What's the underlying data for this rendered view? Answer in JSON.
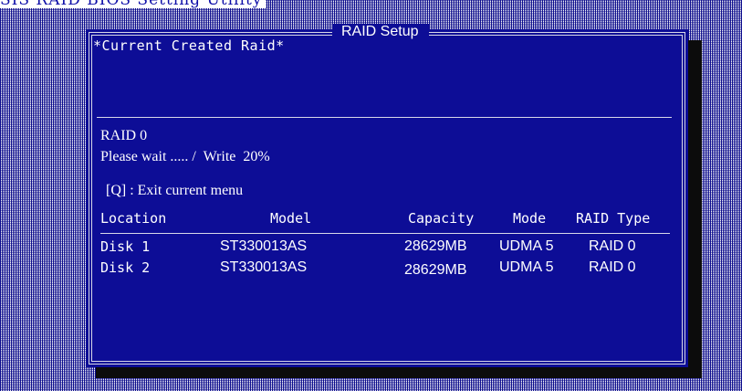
{
  "app_title": "SIS RAID BIOS Setting Utility",
  "panel": {
    "title": "RAID Setup",
    "created_heading": "*Current Created Raid*",
    "raid_label": "RAID 0",
    "progress_text": "Please wait ..... /  Write  20%",
    "progress_percent": 20,
    "exit_hint": "[Q] : Exit current menu"
  },
  "table": {
    "headers": {
      "location": "Location",
      "model": "Model",
      "capacity": "Capacity",
      "mode": "Mode",
      "raid_type": "RAID Type"
    },
    "rows": [
      {
        "location": "Disk 1",
        "model": "ST330013AS",
        "capacity": "28629MB",
        "mode": "UDMA 5",
        "raid_type": "RAID 0"
      },
      {
        "location": "Disk 2",
        "model": "ST330013AS",
        "capacity": "28629MB",
        "mode": "UDMA 5",
        "raid_type": "RAID 0"
      }
    ]
  },
  "colors": {
    "panel_bg": "#0d0da8",
    "text": "#ffffff",
    "title_text": "#0d0da8"
  }
}
